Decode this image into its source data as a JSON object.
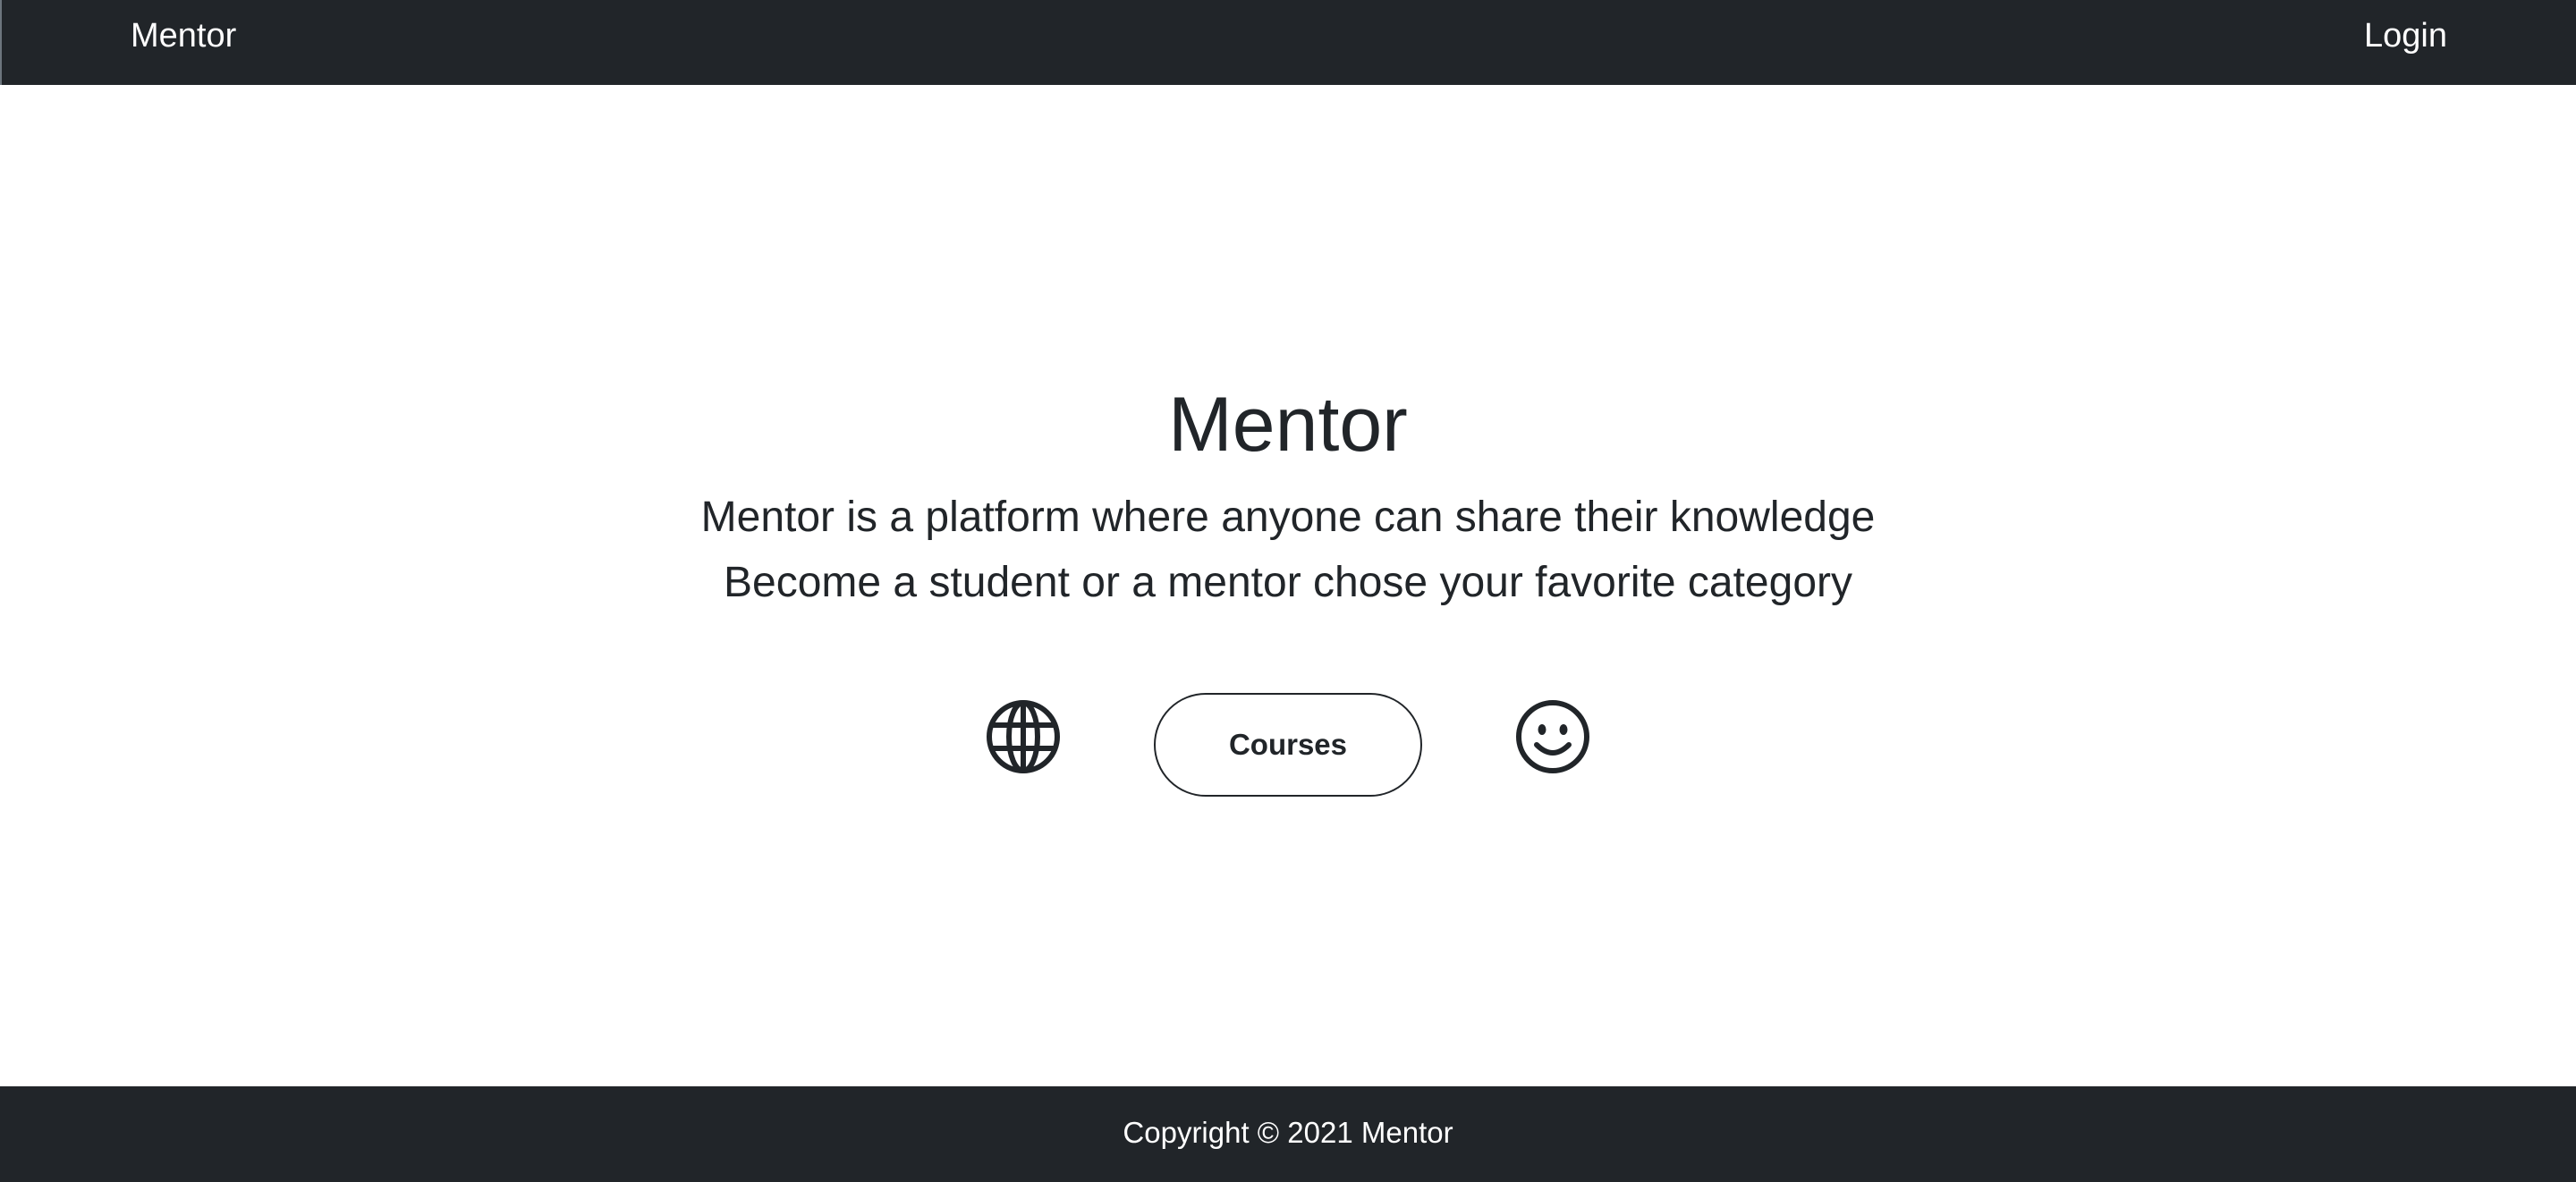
{
  "navbar": {
    "brand": "Mentor",
    "login_label": "Login"
  },
  "hero": {
    "title": "Mentor",
    "line1": "Mentor is a platform where anyone can share their knowledge",
    "line2": "Become a student or a mentor chose your favorite category",
    "courses_label": "Courses",
    "left_icon": "globe-icon",
    "right_icon": "smiley-icon"
  },
  "footer": {
    "copyright": "Copyright © 2021 Mentor"
  },
  "colors": {
    "navbar_bg": "#212529",
    "text": "#212529",
    "navbar_text": "#ffffff"
  }
}
